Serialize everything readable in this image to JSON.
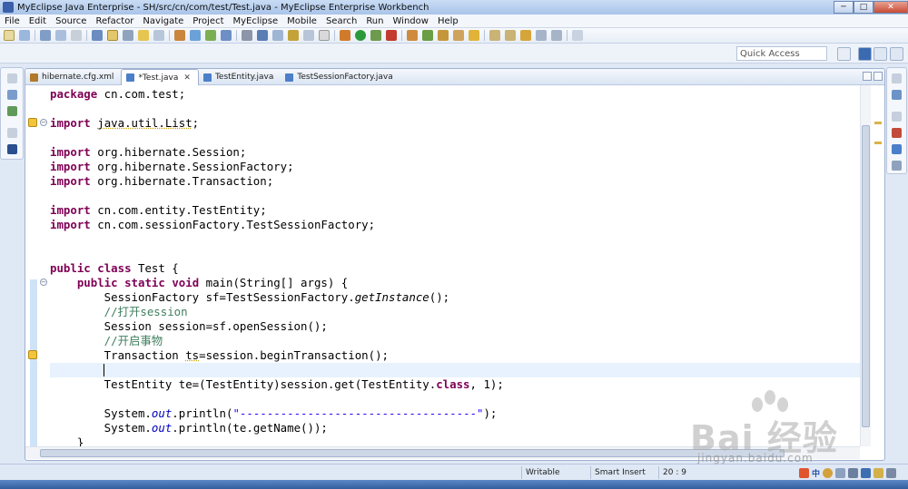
{
  "window": {
    "title": "MyEclipse Java Enterprise - SH/src/cn/com/test/Test.java - MyEclipse Enterprise Workbench",
    "minimize": "─",
    "maximize": "□",
    "close": "✕"
  },
  "menu": [
    "File",
    "Edit",
    "Source",
    "Refactor",
    "Navigate",
    "Project",
    "MyEclipse",
    "Mobile",
    "Search",
    "Run",
    "Window",
    "Help"
  ],
  "quick_access": {
    "placeholder": "Quick Access"
  },
  "tabs": [
    {
      "label": "hibernate.cfg.xml",
      "active": false,
      "icon_color": "#b07a2a"
    },
    {
      "label": "*Test.java",
      "active": true,
      "icon_color": "#4b7fc9",
      "close": "✕"
    },
    {
      "label": "TestEntity.java",
      "active": false,
      "icon_color": "#4b7fc9"
    },
    {
      "label": "TestSessionFactory.java",
      "active": false,
      "icon_color": "#4b7fc9"
    }
  ],
  "code_lines": [
    "package cn.com.test;",
    "",
    "import java.util.List;",
    "",
    "import org.hibernate.Session;",
    "import org.hibernate.SessionFactory;",
    "import org.hibernate.Transaction;",
    "",
    "import cn.com.entity.TestEntity;",
    "import cn.com.sessionFactory.TestSessionFactory;",
    "",
    "",
    "public class Test {",
    "    public static void main(String[] args) {",
    "        SessionFactory sf=TestSessionFactory.getInstance();",
    "        //打开session",
    "        Session session=sf.openSession();",
    "        //开启事物",
    "        Transaction ts=session.beginTransaction();",
    "",
    "        TestEntity te=(TestEntity)session.get(TestEntity.class, 1);",
    "",
    "        System.out.println(\"-----------------------------------\");",
    "        System.out.println(te.getName());",
    "    }"
  ],
  "status": {
    "writable": "Writable",
    "insert_mode": "Smart Insert",
    "position": "20 : 9"
  },
  "tray": {
    "ime": "中"
  },
  "watermark": {
    "text": "Bai 经验",
    "url": "jingyan.baidu.com"
  },
  "colors": {
    "keyword": "#7f0055",
    "comment": "#3f7f5f",
    "string": "#2a00ff",
    "field": "#0000c0",
    "current_line": "#e8f2fe"
  }
}
